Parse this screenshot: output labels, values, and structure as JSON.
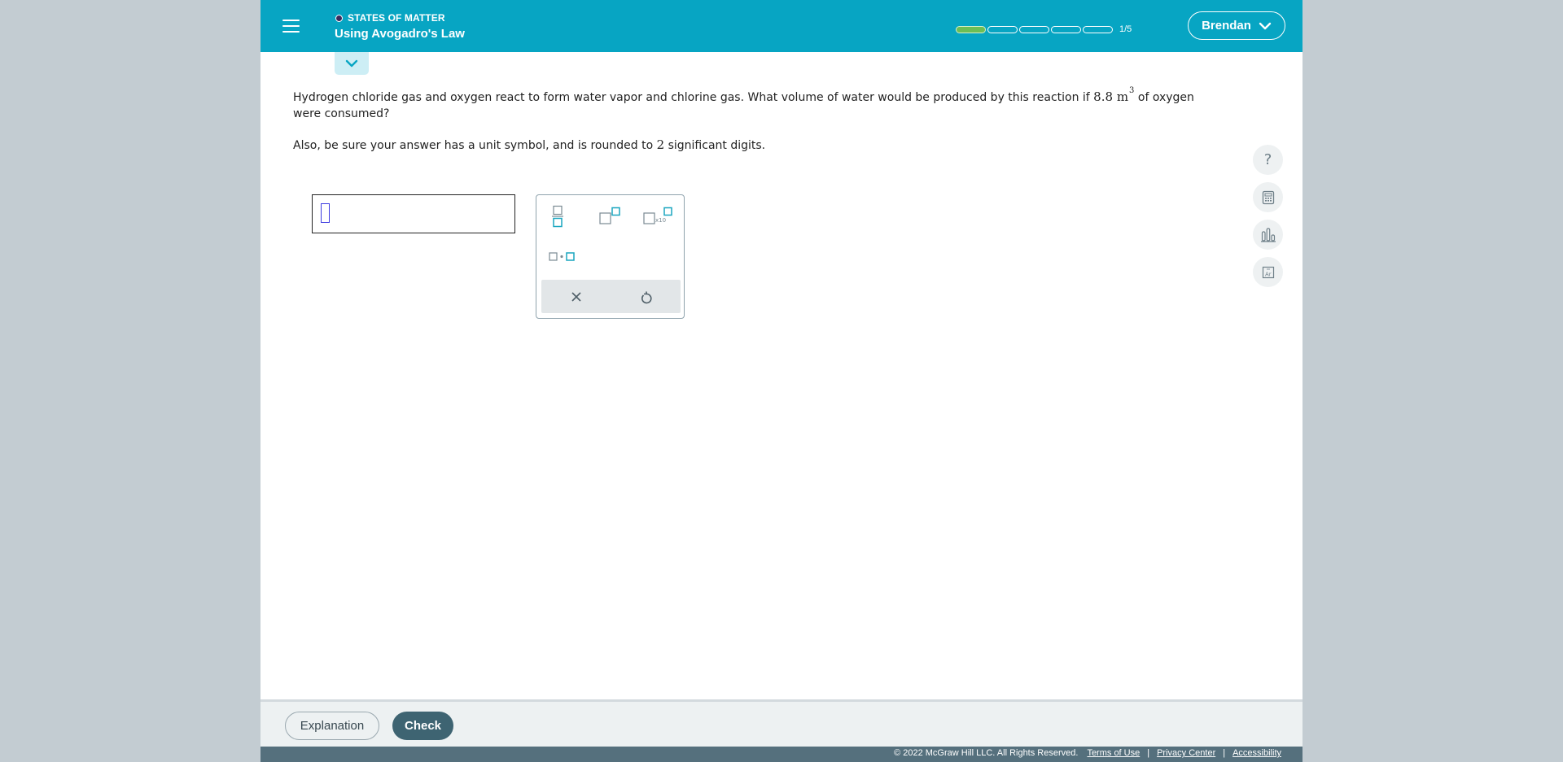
{
  "header": {
    "menu_icon": "hamburger-icon",
    "topic": "STATES OF MATTER",
    "lesson_title": "Using Avogadro's Law",
    "progress": {
      "completed": 1,
      "total": 5,
      "label": "1/5"
    },
    "user_name": "Brendan",
    "expand_icon": "chevron-down-icon"
  },
  "question": {
    "text_before": "Hydrogen chloride gas and oxygen react to form water vapor and chlorine gas. What volume of water would be produced by this reaction if ",
    "value": "8.8",
    "unit": "m",
    "unit_exponent": "3",
    "text_after": " of oxygen were consumed?",
    "line2_before": "Also, be sure your answer has a unit symbol, and is rounded to ",
    "sig_digits": "2",
    "line2_after": " significant digits."
  },
  "answer": {
    "value": "",
    "placeholder": ""
  },
  "palette": {
    "buttons": [
      "fraction-icon",
      "superscript-icon",
      "scientific-notation-icon",
      "multiply-dot-icon"
    ],
    "sci_label": "x10",
    "actions": [
      "clear-icon",
      "undo-icon"
    ]
  },
  "tools": [
    "help-icon",
    "calculator-icon",
    "data-chart-icon",
    "periodic-table-icon"
  ],
  "tool_labels": {
    "help": "?"
  },
  "footer": {
    "explanation_label": "Explanation",
    "check_label": "Check",
    "copyright": "© 2022 McGraw Hill LLC. All Rights Reserved.",
    "terms": "Terms of Use",
    "privacy": "Privacy Center",
    "accessibility": "Accessibility"
  },
  "colors": {
    "header": "#07a5c3",
    "progress_fill": "#6cbe55",
    "check_button": "#3e6472",
    "footer_bar": "#55707d",
    "palette_accent": "#1aa6bf"
  }
}
